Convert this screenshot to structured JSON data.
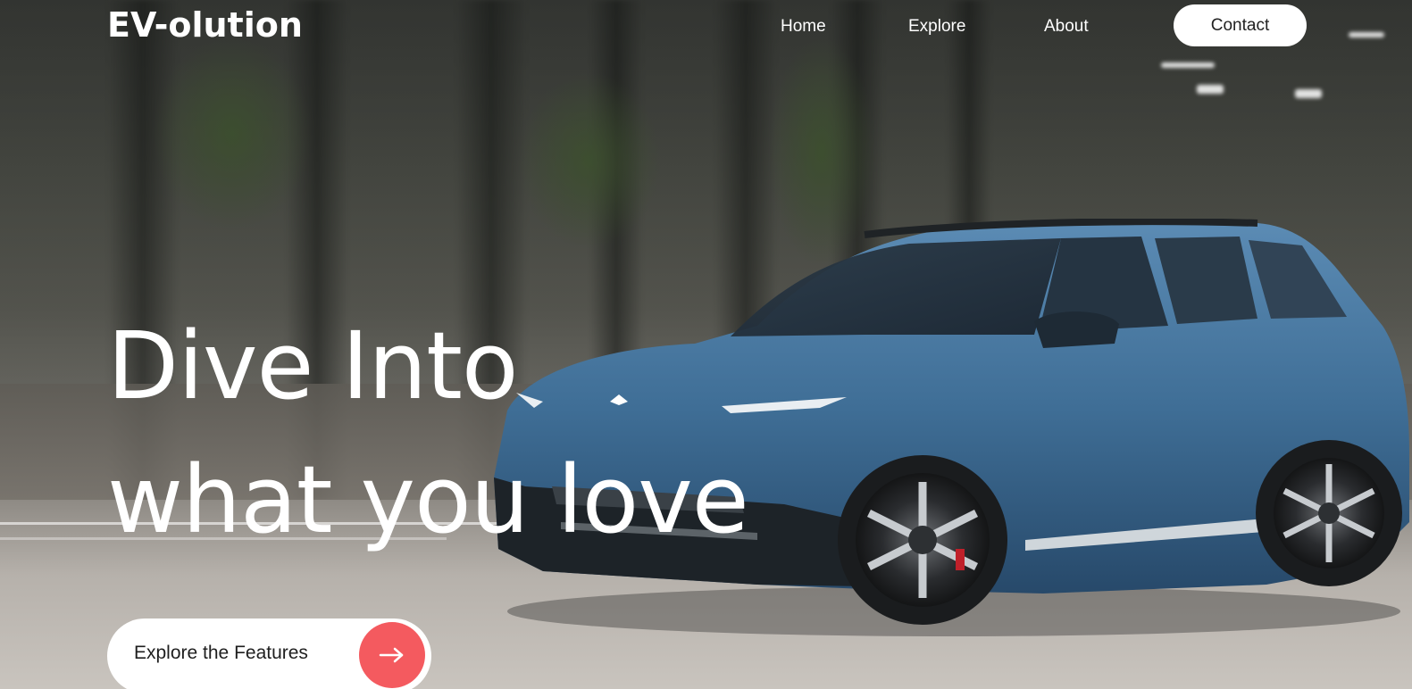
{
  "header": {
    "logo": "EV-olution",
    "nav": {
      "home": "Home",
      "explore": "Explore",
      "about": "About",
      "contact": "Contact"
    }
  },
  "hero": {
    "headline_line1": "Dive Into",
    "headline_line2": "what you love",
    "cta_label": "Explore the Features",
    "cta_icon": "arrow-right-icon",
    "car_icon": "blue-suv-image"
  },
  "colors": {
    "accent": "#f45a5f",
    "car_body": "#3f6e96",
    "text_light": "#ffffff"
  }
}
